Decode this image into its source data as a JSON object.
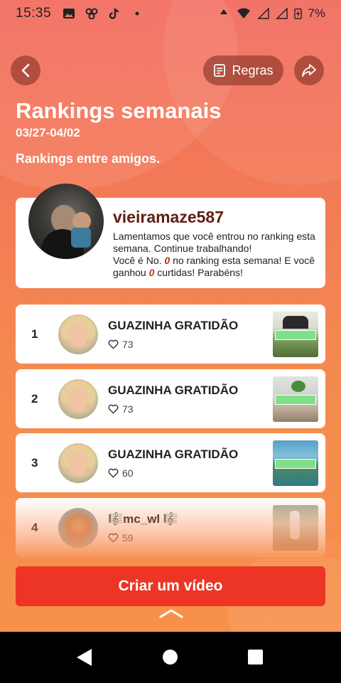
{
  "status_bar": {
    "time": "15:35",
    "battery": "7%",
    "icons": [
      "image-icon",
      "app-icon",
      "tiktok-icon",
      "dot-icon",
      "wifi-icon",
      "signal-icon",
      "signal-icon",
      "battery-charging-icon"
    ]
  },
  "header": {
    "rules_label": "Regras",
    "title": "Rankings semanais",
    "dates": "03/27-04/02",
    "subtitle": "Rankings entre amigos."
  },
  "user_card": {
    "username": "vieiramaze587",
    "message_line1": "Lamentamos que você entrou no ranking esta semana. Continue trabalhando!",
    "message_part1": "Você é No. ",
    "rank_number": "0",
    "message_part2": " no ranking esta semana! E você ganhou ",
    "likes_number": "0",
    "message_part3": " curtidas! Parabéns!"
  },
  "rankings": [
    {
      "position": "1",
      "name": "GUAZINHA GRATIDÃO",
      "likes": "73"
    },
    {
      "position": "2",
      "name": "GUAZINHA GRATIDÃO",
      "likes": "73"
    },
    {
      "position": "3",
      "name": "GUAZINHA GRATIDÃO",
      "likes": "60"
    },
    {
      "position": "4",
      "name": "🎼mc_wl 🎼",
      "likes": "59"
    }
  ],
  "cta": {
    "label": "Criar um vídeo"
  },
  "colors": {
    "background_top": "#f26a5e",
    "background_bottom": "#f7914a",
    "cta": "#ec3525",
    "username": "#5e1f12"
  }
}
